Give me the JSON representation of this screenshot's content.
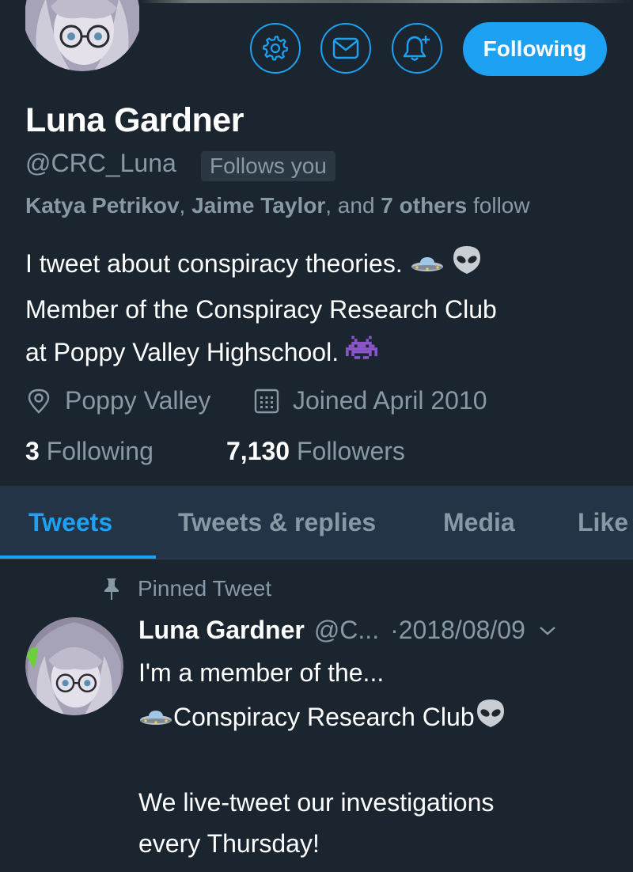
{
  "header": {
    "follow_button": "Following",
    "icons": [
      "gear-icon",
      "mail-icon",
      "bell-add-icon"
    ],
    "accent": "#1da1f2"
  },
  "profile": {
    "name": "Luna Gardner",
    "handle": "@CRC_Luna",
    "follows_you": "Follows you",
    "mutuals": {
      "name1": "Katya Petrikov",
      "sep1": ", ",
      "name2": "Jaime Taylor",
      "sep2": ", and ",
      "others": "7 others",
      "suffix": " follow"
    },
    "bio": {
      "line1": "I tweet about conspiracy theories. ",
      "line2": "Member of the Conspiracy Research Club",
      "line3": "at Poppy Valley Highschool. "
    },
    "location": "Poppy Valley",
    "joined": "Joined April 2010",
    "following_count": "3",
    "following_label": " Following",
    "followers_count": "7,130",
    "followers_label": " Followers"
  },
  "tabs": [
    {
      "label": "Tweets",
      "active": true
    },
    {
      "label": "Tweets & replies",
      "active": false
    },
    {
      "label": "Media",
      "active": false
    },
    {
      "label": "Like",
      "active": false
    }
  ],
  "pinned_tweet": {
    "pinned_label": "Pinned Tweet",
    "author": "Luna Gardner",
    "handle": "@C...",
    "date": "·2018/08/09",
    "line1": "I'm a member of the...",
    "line2": "Conspiracy Research Club",
    "line3": "",
    "line4": "We live-tweet our investigations",
    "line5": "every Thursday!"
  }
}
